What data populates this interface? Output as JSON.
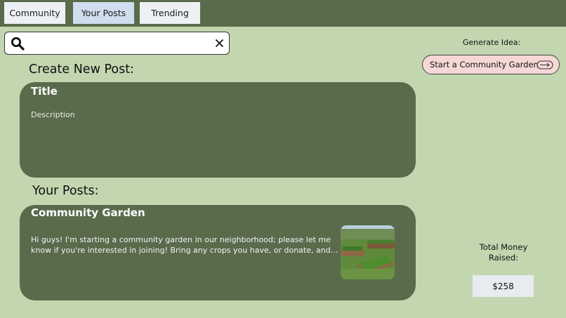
{
  "nav": {
    "tabs": [
      {
        "label": "Community"
      },
      {
        "label": "Your Posts"
      },
      {
        "label": "Trending"
      }
    ]
  },
  "search": {
    "value": "",
    "placeholder": "",
    "icon": "search-icon",
    "clear_icon": "close-icon"
  },
  "create": {
    "heading": "Create New Post:",
    "title_placeholder": "Title",
    "description_placeholder": "Description"
  },
  "your_posts": {
    "heading": "Your Posts:",
    "posts": [
      {
        "title": "Community Garden",
        "body": "Hi guys! I'm starting a community garden in our neighborhood; please let me know if you're interested in joining! Bring any crops you have, or donate, and we will be getting started soon!"
      }
    ]
  },
  "idea": {
    "label": "Generate Idea:",
    "button_label": "Start a Community Garden",
    "icon": "arrow-right-icon"
  },
  "fundraising": {
    "label": "Total Money Raised:",
    "amount": "$258"
  },
  "colors": {
    "background": "#c2d6b0",
    "dark_green": "#5a6b4c",
    "tab_light": "#eef1f4",
    "tab_active": "#cfddef",
    "idea_button": "#f5d8d6"
  }
}
